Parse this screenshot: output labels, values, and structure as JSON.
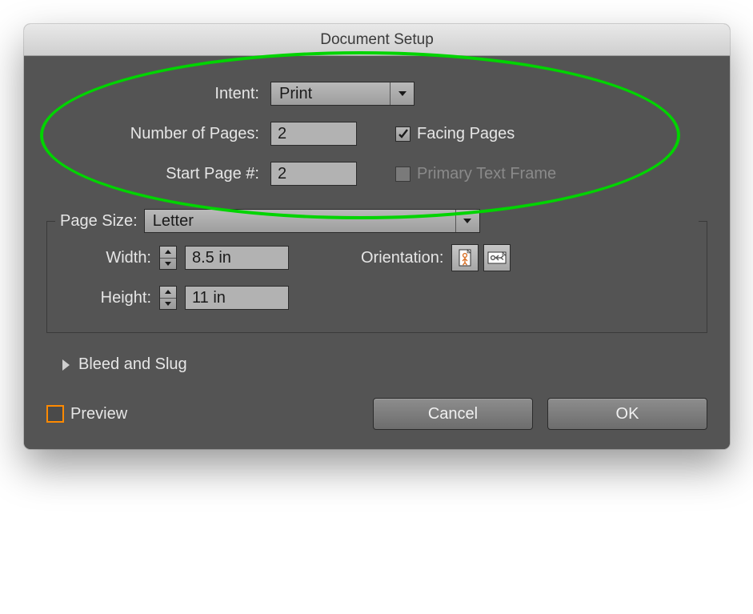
{
  "title": "Document Setup",
  "intent": {
    "label": "Intent:",
    "value": "Print"
  },
  "pages": {
    "label": "Number of Pages:",
    "value": "2"
  },
  "start": {
    "label": "Start Page #:",
    "value": "2"
  },
  "facing": {
    "label": "Facing Pages",
    "checked": true
  },
  "primary": {
    "label": "Primary Text Frame",
    "checked": false
  },
  "pagesize": {
    "label": "Page Size:",
    "value": "Letter"
  },
  "width": {
    "label": "Width:",
    "value": "8.5 in"
  },
  "height": {
    "label": "Height:",
    "value": "11 in"
  },
  "orientation": {
    "label": "Orientation:"
  },
  "bleed": {
    "label": "Bleed and Slug"
  },
  "preview": {
    "label": "Preview"
  },
  "buttons": {
    "cancel": "Cancel",
    "ok": "OK"
  }
}
